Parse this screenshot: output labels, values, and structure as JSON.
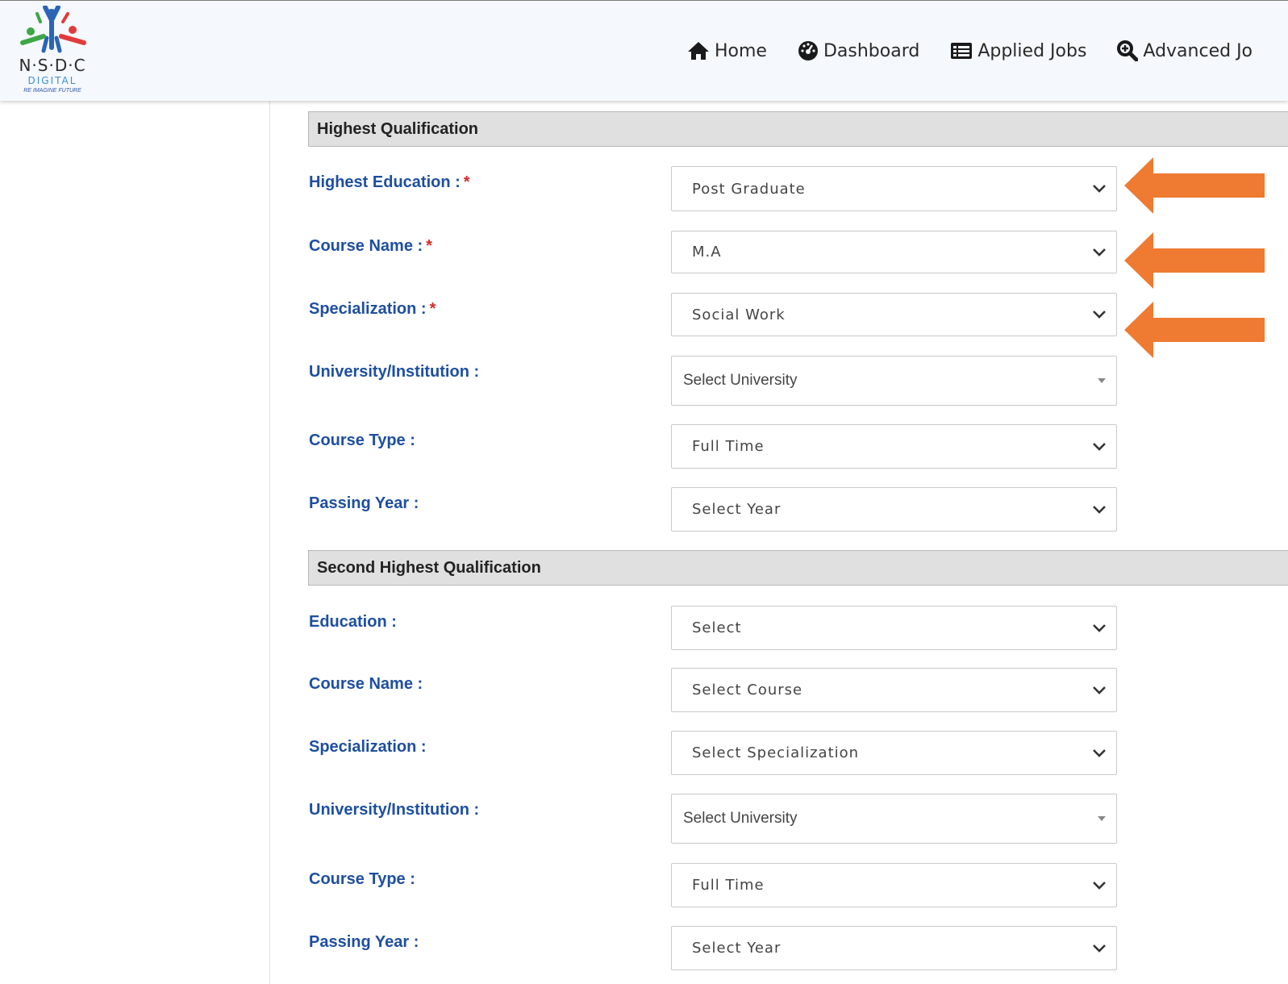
{
  "brand": {
    "name": "N·S·D·C",
    "sub": "DIGITAL",
    "tagline": "RE IMAGINE FUTURE"
  },
  "nav": [
    {
      "label": "Home",
      "icon": "home-icon"
    },
    {
      "label": "Dashboard",
      "icon": "dashboard-icon"
    },
    {
      "label": "Applied Jobs",
      "icon": "list-icon"
    },
    {
      "label": "Advanced Jo",
      "icon": "search-icon"
    }
  ],
  "highest": {
    "title": "Highest Qualification",
    "education": {
      "label": "Highest Education :",
      "required": "*",
      "value": "Post Graduate"
    },
    "course": {
      "label": "Course Name :",
      "required": "*",
      "value": "M.A"
    },
    "specialization": {
      "label": "Specialization :",
      "required": "*",
      "value": "Social Work"
    },
    "university": {
      "label": "University/Institution :",
      "value": "Select University"
    },
    "course_type": {
      "label": "Course Type :",
      "value": "Full Time"
    },
    "passing_year": {
      "label": "Passing Year :",
      "value": "Select Year"
    }
  },
  "second": {
    "title": "Second Highest Qualification",
    "education": {
      "label": "Education :",
      "value": "Select"
    },
    "course": {
      "label": "Course Name :",
      "value": "Select Course"
    },
    "specialization": {
      "label": "Specialization :",
      "value": "Select Specialization"
    },
    "university": {
      "label": "University/Institution :",
      "value": "Select University"
    },
    "course_type": {
      "label": "Course Type :",
      "value": "Full Time"
    },
    "passing_year": {
      "label": "Passing Year :",
      "value": "Select Year"
    }
  },
  "colors": {
    "label": "#1e4fa0",
    "required": "#d42a2a",
    "arrow": "#ee7b31",
    "header_bg": "#e0e0e0"
  }
}
